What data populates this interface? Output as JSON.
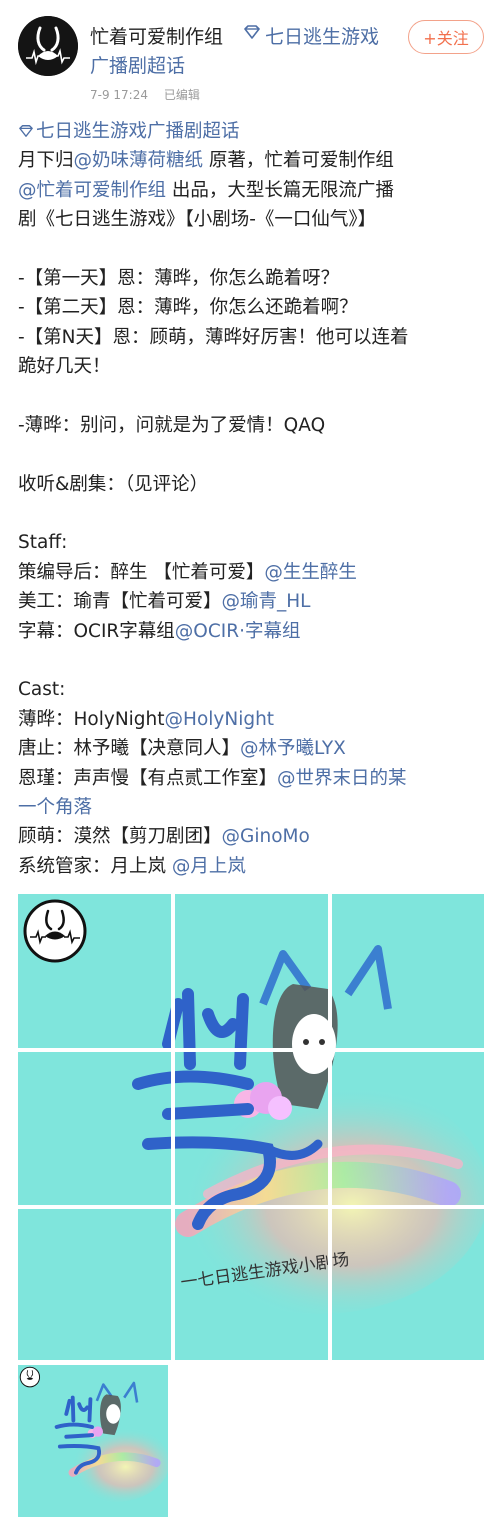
{
  "post": {
    "author_name": "忙着可爱制作组",
    "super_topic_part1": "七日逃生游戏",
    "super_topic_part2": "广播剧超话",
    "follow_label": "+关注",
    "date": "7-9 17:24",
    "edited": "已编辑"
  },
  "content": {
    "topic_link": "七日逃生游戏广播剧超话",
    "intro": {
      "seg1": "月下归",
      "mention1": "@奶味薄荷糖纸",
      "seg2": " 原著，忙着可爱制作组",
      "mention2": "@忙着可爱制作组",
      "seg3": " 出品，大型长篇无限流广播",
      "line3": "剧《七日逃生游戏》【小剧场-《一口仙气》】"
    },
    "days": [
      "-【第一天】恩：薄晔，你怎么跪着呀？",
      "-【第二天】恩：薄晔，你怎么还跪着啊？",
      "-【第N天】恩：顾萌，薄晔好厉害！他可以连着",
      "跪好几天！"
    ],
    "quote": "-薄晔：别问，问就是为了爱情！QAQ",
    "listen": "收听&剧集：（见评论）",
    "staff_title": "Staff:",
    "staff": [
      {
        "role": "策编导后：醉生 【忙着可爱】",
        "mention": "@生生醉生"
      },
      {
        "role": "美工：瑜青【忙着可爱】",
        "mention": "@瑜青_HL"
      },
      {
        "role": "字幕：OCIR字幕组",
        "mention": "@OCIR·字幕组"
      }
    ],
    "cast_title": "Cast:",
    "cast": [
      {
        "role": "薄晔：HolyNight",
        "mention": "@HolyNight"
      },
      {
        "role": "唐止：林予曦【决意同人】",
        "mention": "@林予曦LYX"
      },
      {
        "role": "恩瑾：声声慢【有点贰工作室】",
        "mention": "@世界末日的某",
        "mention_cont": "一个角落"
      },
      {
        "role": "顾萌：漠然【剪刀剧团】",
        "mention": "@GinoMo"
      },
      {
        "role": "系统管家：月上岚 ",
        "mention": "@月上岚"
      }
    ]
  },
  "images": {
    "poster_caption": "一七日逃生游戏小剧场",
    "colors": {
      "background": "#7fe5dc",
      "link": "#4e6fa6",
      "follow": "#f2704d"
    }
  }
}
